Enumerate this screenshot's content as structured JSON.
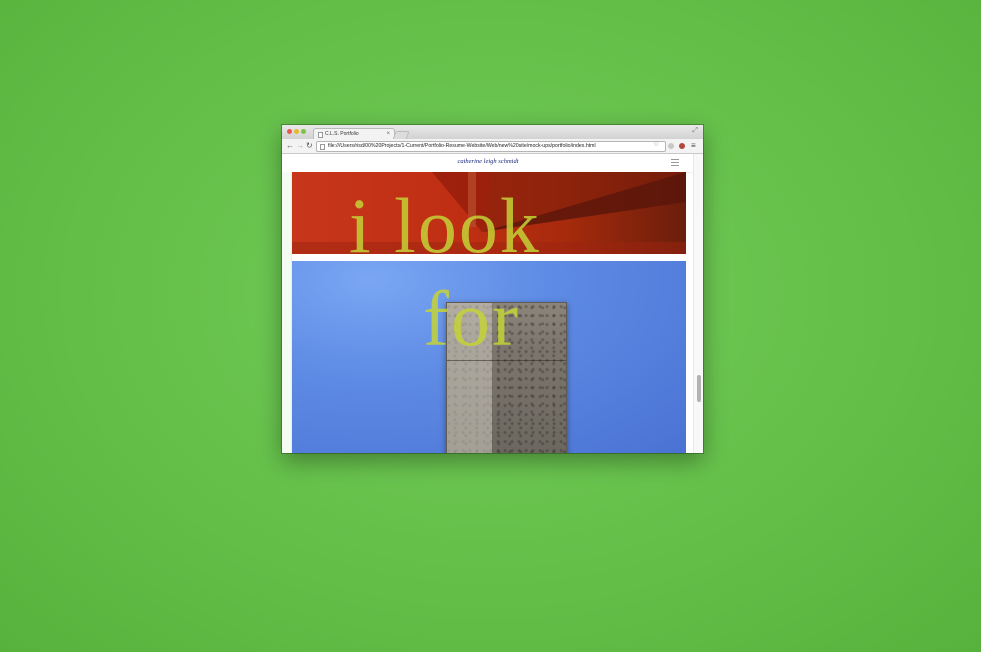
{
  "browser": {
    "tab_title": "C.L.S. Portfolio",
    "tab_close": "×",
    "url": "file:///Users/risd/00%20Projects/1-Current/Portfolio-Resume-Website/Web/new%20site/mock-ups/portfolio/index.html",
    "back_glyph": "←",
    "forward_glyph": "→",
    "reload_glyph": "↻",
    "star_glyph": "☆",
    "menu_glyph": "≡",
    "fullscreen_glyph": "⤢"
  },
  "site": {
    "title": "catherine leigh schmidt"
  },
  "overlay": {
    "line1": "i look",
    "line2": "for"
  },
  "colors": {
    "background": "#66c44b",
    "overlay_text": "#c4d237",
    "site_title": "#1b2a7a",
    "red_panel": "#c7361b",
    "blue_panel": "#5e8be4"
  }
}
